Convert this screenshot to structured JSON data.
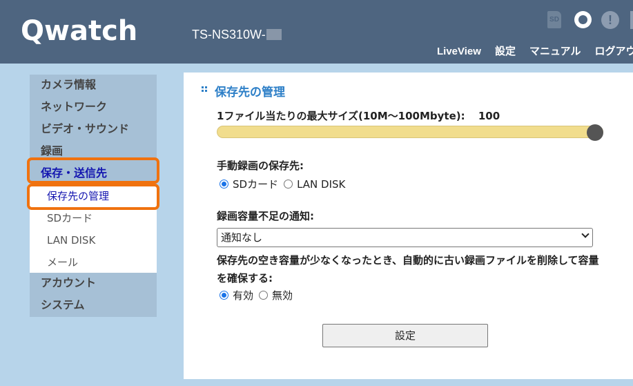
{
  "header": {
    "logo": "Qwatch",
    "device_name": "TS-NS310W-",
    "sd_label": "SD",
    "warn_glyph": "!",
    "nav": [
      "LiveView",
      "設定",
      "マニュアル",
      "ログアウ"
    ]
  },
  "sidebar": {
    "camera_info": "カメラ情報",
    "network": "ネットワーク",
    "video_sound": "ビデオ・サウンド",
    "recording": "録画",
    "storage_send": "保存・送信先",
    "storage_manage": "保存先の管理",
    "sd_card": "SDカード",
    "lan_disk": "LAN DISK",
    "mail": "メール",
    "account": "アカウント",
    "system": "システム"
  },
  "main": {
    "title": "保存先の管理",
    "max_size_label": "1ファイル当たりの最大サイズ(10M〜100Mbyte):",
    "max_size_value": "100",
    "max_size_fraction": 1.0,
    "manual_dest_label": "手動録画の保存先:",
    "dest_options": [
      "SDカード",
      "LAN DISK"
    ],
    "dest_selected": "SDカード",
    "notify_label": "録画容量不足の通知:",
    "notify_value": "通知なし",
    "overwrite_desc": "保存先の空き容量が少なくなったとき、自動的に古い録画ファイルを削除して容量を確保する:",
    "overwrite_options": [
      "有効",
      "無効"
    ],
    "overwrite_selected": "有効",
    "submit_label": "設定"
  },
  "colors": {
    "header_bg": "#4e6580",
    "page_bg": "#b7d4ea",
    "sidebar_cat_bg": "#a6c0d6",
    "accent_blue": "#2d7fc7",
    "active_text": "#1416b0",
    "highlight_orange": "#f0720f",
    "slider_track": "#f1dd8d"
  },
  "icons": [
    "sd-card-icon",
    "record-status-icon",
    "warning-icon",
    "section-grid-icon",
    "chevron-down-icon"
  ]
}
